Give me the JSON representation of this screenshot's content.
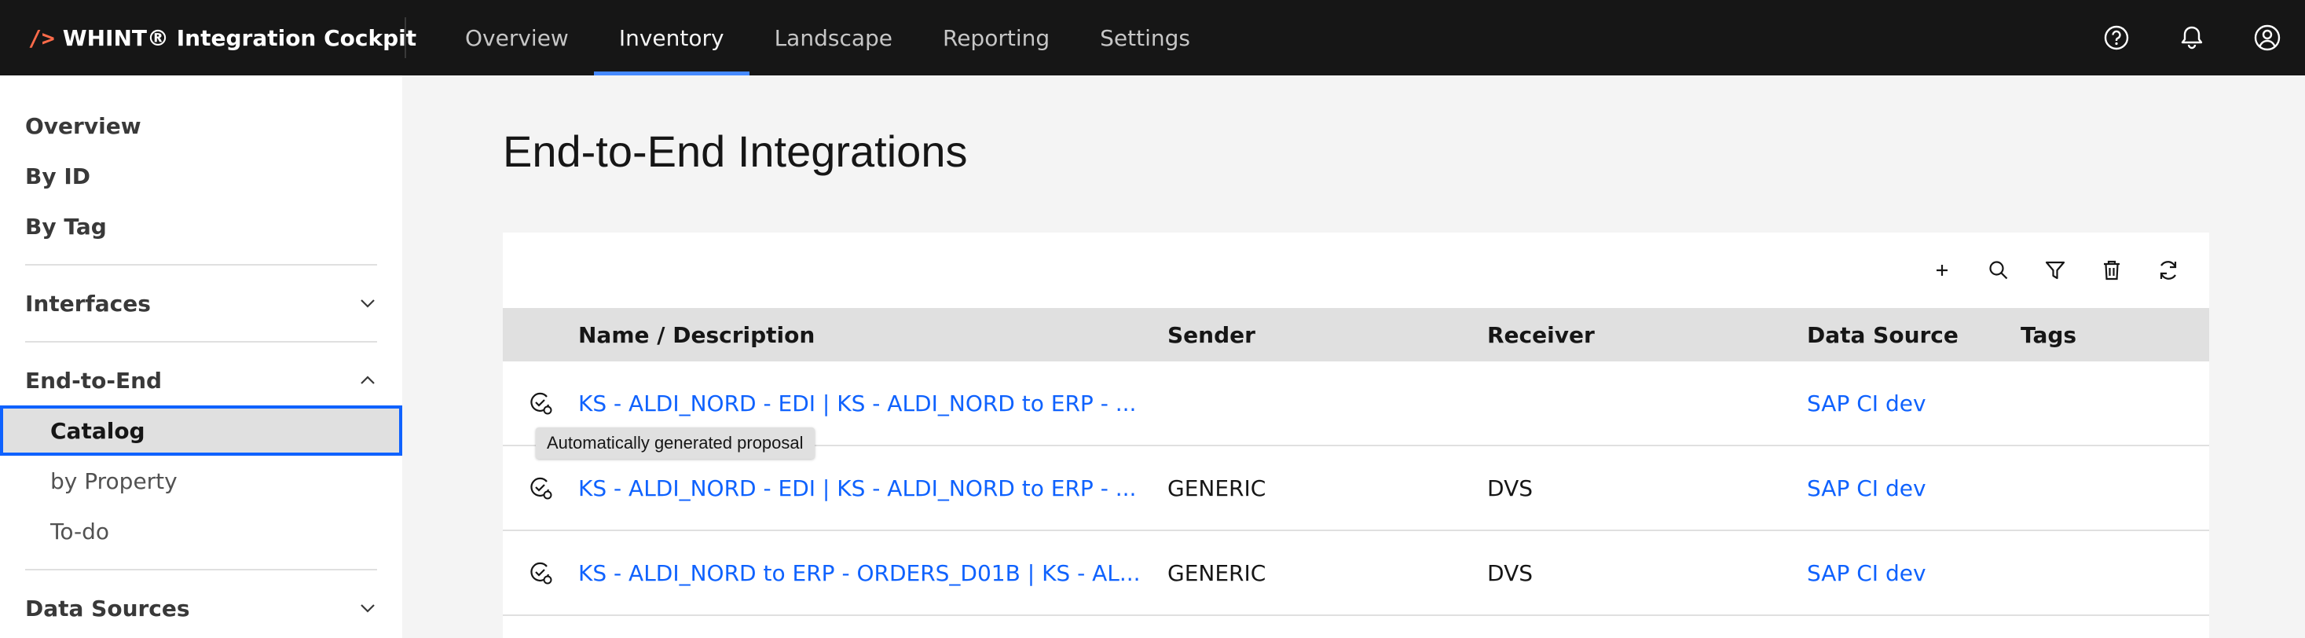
{
  "header": {
    "brand_slash": "/>",
    "brand_name": "WHINT® Integration Cockpit",
    "nav": [
      "Overview",
      "Inventory",
      "Landscape",
      "Reporting",
      "Settings"
    ],
    "active_nav": "Inventory",
    "icons": [
      "help-icon",
      "notification-icon",
      "user-avatar-icon"
    ]
  },
  "sidebar": {
    "overview": "Overview",
    "by_id": "By ID",
    "by_tag": "By Tag",
    "interfaces": "Interfaces",
    "end_to_end": "End-to-End",
    "catalog": "Catalog",
    "by_property": "by Property",
    "todo": "To-do",
    "data_sources": "Data Sources"
  },
  "main": {
    "title": "End-to-End Integrations",
    "toolbar_icons": [
      "add-icon",
      "search-icon",
      "filter-icon",
      "delete-icon",
      "refresh-icon"
    ],
    "columns": {
      "name": "Name / Description",
      "sender": "Sender",
      "receiver": "Receiver",
      "data_source": "Data Source",
      "tags": "Tags"
    },
    "rows": [
      {
        "name": "KS - ALDI_NORD - EDI | KS - ALDI_NORD to ERP - ...",
        "sender": "",
        "receiver": "",
        "data_source": "SAP CI dev",
        "tags": ""
      },
      {
        "name": "KS - ALDI_NORD - EDI | KS - ALDI_NORD to ERP - ...",
        "sender": "GENERIC",
        "receiver": "DVS",
        "data_source": "SAP CI dev",
        "tags": ""
      },
      {
        "name": "KS - ALDI_NORD to ERP - ORDERS_D01B | KS - AL...",
        "sender": "GENERIC",
        "receiver": "DVS",
        "data_source": "SAP CI dev",
        "tags": ""
      }
    ],
    "tooltip": "Automatically generated proposal"
  },
  "colors": {
    "header_bg": "#161616",
    "accent": "#0f62fe",
    "active_tab_underline": "#4589ff",
    "brand_slash": "#ff6b4a"
  }
}
